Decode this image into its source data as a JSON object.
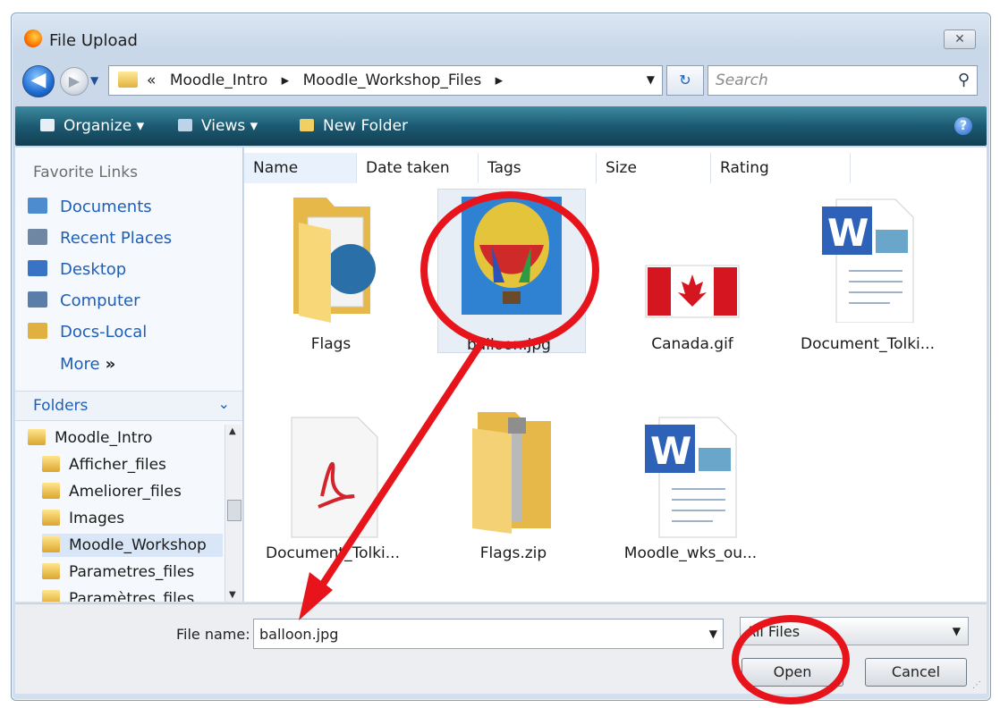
{
  "window": {
    "title": "File Upload",
    "close_glyph": "✕"
  },
  "navigation": {
    "back_glyph": "◀",
    "forward_glyph": "▶",
    "history_glyph": "▼",
    "breadcrumb_prefix": "«",
    "breadcrumbs": [
      "Moodle_Intro",
      "Moodle_Workshop_Files"
    ],
    "separator": "▸",
    "address_dropdown_glyph": "▼",
    "refresh_glyph": "↻",
    "search_placeholder": "Search",
    "search_icon": "⚲"
  },
  "toolbar": {
    "organize_label": "Organize ▾",
    "views_label": "Views ▾",
    "new_folder_label": "New Folder",
    "help_label": "?"
  },
  "nav_pane": {
    "favorites_heading": "Favorite Links",
    "favorites": [
      {
        "label": "Documents",
        "icon": "documents-icon",
        "color": "#4c8ccf"
      },
      {
        "label": "Recent Places",
        "icon": "recent-places-icon",
        "color": "#6f87a3"
      },
      {
        "label": "Desktop",
        "icon": "desktop-icon",
        "color": "#3a72c4"
      },
      {
        "label": "Computer",
        "icon": "computer-icon",
        "color": "#5a7ea8"
      },
      {
        "label": "Docs-Local",
        "icon": "folder-icon",
        "color": "#e0b040"
      }
    ],
    "more_label": "More",
    "more_glyph": "»",
    "folders_heading": "Folders",
    "folders_chevron": "⌄",
    "tree": [
      {
        "label": "Moodle_Intro",
        "indent": 0,
        "selected": false
      },
      {
        "label": "Afficher_files",
        "indent": 1,
        "selected": false
      },
      {
        "label": "Ameliorer_files",
        "indent": 1,
        "selected": false
      },
      {
        "label": "Images",
        "indent": 1,
        "selected": false
      },
      {
        "label": "Moodle_Workshop",
        "indent": 1,
        "selected": true
      },
      {
        "label": "Parametres_files",
        "indent": 1,
        "selected": false
      },
      {
        "label": "Paramètres_files",
        "indent": 1,
        "selected": false
      }
    ]
  },
  "columns": [
    "Name",
    "Date taken",
    "Tags",
    "Size",
    "Rating"
  ],
  "files": [
    {
      "label": "Flags",
      "type": "folder",
      "selected": false
    },
    {
      "label": "balloon.jpg",
      "type": "image",
      "selected": true
    },
    {
      "label": "Canada.gif",
      "type": "flag",
      "selected": false
    },
    {
      "label": "Document_Tolki...",
      "type": "word",
      "selected": false
    },
    {
      "label": "Document_Tolki...",
      "type": "pdf",
      "selected": false
    },
    {
      "label": "Flags.zip",
      "type": "zip",
      "selected": false
    },
    {
      "label": "Moodle_wks_ou...",
      "type": "word",
      "selected": false
    }
  ],
  "bottom": {
    "file_name_label": "File name:",
    "file_name_value": "balloon.jpg",
    "filter_value": "All Files",
    "open_label": "Open",
    "cancel_label": "Cancel"
  },
  "colors": {
    "annotation": "#e8141b",
    "toolbar": "#1c5a72",
    "link": "#1f5fb8"
  }
}
